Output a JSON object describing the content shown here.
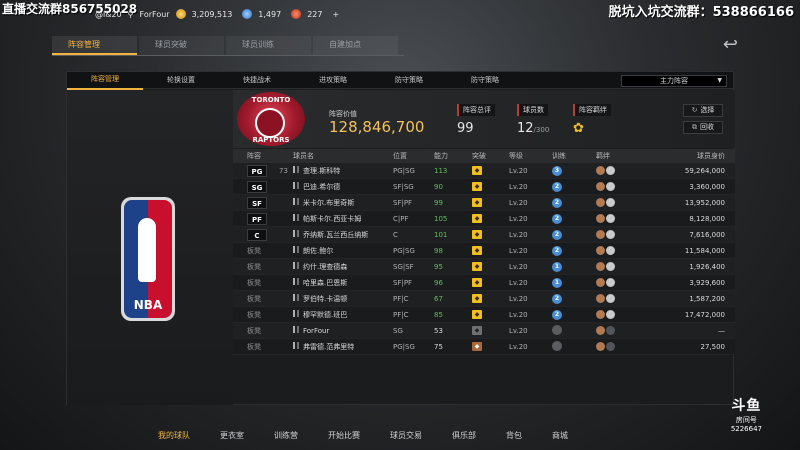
{
  "overlay": {
    "left": "直播交流群856755028",
    "right": "脱坑入坑交流群：538866166"
  },
  "topbar": {
    "user": "@l&20",
    "name": "ForFour",
    "gold": "3,209,513",
    "blue": "1,497",
    "red": "227",
    "plus": "+"
  },
  "maintabs": [
    {
      "label": "阵容管理",
      "active": true
    },
    {
      "label": "球员突破",
      "active": false
    },
    {
      "label": "球员训练",
      "active": false
    },
    {
      "label": "自建加点",
      "active": false
    }
  ],
  "subtabs": [
    {
      "label": "阵容管理",
      "active": true
    },
    {
      "label": "轮换设置",
      "active": false
    },
    {
      "label": "快捷战术",
      "active": false
    },
    {
      "label": "进攻策略",
      "active": false
    },
    {
      "label": "防守策略",
      "active": false
    },
    {
      "label": "防守策略",
      "active": false
    }
  ],
  "sort_select": "主力阵容",
  "team": {
    "logo_top": "TORONTO",
    "logo_bottom": "RAPTORS",
    "value_label": "阵容价值",
    "value": "128,846,700",
    "rating_label": "阵容总评",
    "rating": "99",
    "count_label": "球员数",
    "count": "12",
    "count_max": "/300",
    "bond_label": "阵容羁绊",
    "select_btn": "选择",
    "recycle_btn": "回收"
  },
  "nba_logo_text": "NBA",
  "table": {
    "headers": [
      "阵容",
      "球员名",
      "位置",
      "能力",
      "突破",
      "等级",
      "训练",
      "羁绊",
      "球员身价"
    ],
    "rows": [
      {
        "pos": "PG",
        "starter": true,
        "num": "73",
        "name": "查理.斯科特",
        "place": "PG|SG",
        "ability": "113",
        "green": true,
        "lv": "Lv.20",
        "train": "3",
        "value": "59,264,000"
      },
      {
        "pos": "SG",
        "starter": true,
        "num": "",
        "name": "巴迪.希尔德",
        "place": "SF|SG",
        "ability": "90",
        "green": true,
        "lv": "Lv.20",
        "train": "2",
        "value": "3,360,000"
      },
      {
        "pos": "SF",
        "starter": true,
        "num": "",
        "name": "米卡尔.布里奇斯",
        "place": "SF|PF",
        "ability": "99",
        "green": true,
        "lv": "Lv.20",
        "train": "2",
        "value": "13,952,000"
      },
      {
        "pos": "PF",
        "starter": true,
        "num": "",
        "name": "帕斯卡尔.西亚卡姆",
        "place": "C|PF",
        "ability": "105",
        "green": true,
        "lv": "Lv.20",
        "train": "2",
        "value": "8,128,000"
      },
      {
        "pos": "C",
        "starter": true,
        "num": "",
        "name": "乔纳斯.瓦兰西丘纳斯",
        "place": "C",
        "ability": "101",
        "green": true,
        "lv": "Lv.20",
        "train": "2",
        "value": "7,616,000"
      },
      {
        "pos": "板凳",
        "starter": false,
        "num": "",
        "name": "朗佐.鲍尔",
        "place": "PG|SG",
        "ability": "98",
        "green": true,
        "lv": "Lv.20",
        "train": "2",
        "value": "11,584,000"
      },
      {
        "pos": "板凳",
        "starter": false,
        "num": "",
        "name": "约什.理查德森",
        "place": "SG|SF",
        "ability": "95",
        "green": true,
        "lv": "Lv.20",
        "train": "1",
        "value": "1,926,400"
      },
      {
        "pos": "板凳",
        "starter": false,
        "num": "",
        "name": "哈里森.巴恩斯",
        "place": "SF|PF",
        "ability": "96",
        "green": true,
        "lv": "Lv.20",
        "train": "1",
        "value": "3,929,600"
      },
      {
        "pos": "板凳",
        "starter": false,
        "num": "",
        "name": "罗伯特.卡温顿",
        "place": "PF|C",
        "ability": "67",
        "green": true,
        "lv": "Lv.20",
        "train": "2",
        "value": "1,587,200"
      },
      {
        "pos": "板凳",
        "starter": false,
        "num": "",
        "name": "穆罕默德.班巴",
        "place": "PF|C",
        "ability": "85",
        "green": true,
        "lv": "Lv.20",
        "train": "2",
        "value": "17,472,000"
      },
      {
        "pos": "板凳",
        "starter": false,
        "num": "",
        "name": "ForFour",
        "place": "SG",
        "ability": "53",
        "green": false,
        "lv": "Lv.20",
        "train": "",
        "value": "—"
      },
      {
        "pos": "板凳",
        "starter": false,
        "num": "",
        "name": "弗雷德.范弗里特",
        "place": "PG|SG",
        "ability": "75",
        "green": false,
        "lv": "Lv.20",
        "train": "",
        "value": "27,500"
      }
    ]
  },
  "bottomnav": [
    {
      "label": "我的球队",
      "active": true
    },
    {
      "label": "更衣室",
      "active": false
    },
    {
      "label": "训练营",
      "active": false
    },
    {
      "label": "开始比赛",
      "active": false
    },
    {
      "label": "球员交易",
      "active": false
    },
    {
      "label": "俱乐部",
      "active": false
    },
    {
      "label": "背包",
      "active": false
    },
    {
      "label": "商城",
      "active": false
    }
  ],
  "douyu": {
    "logo": "斗鱼",
    "sub": "房间号",
    "room": "5226647"
  }
}
